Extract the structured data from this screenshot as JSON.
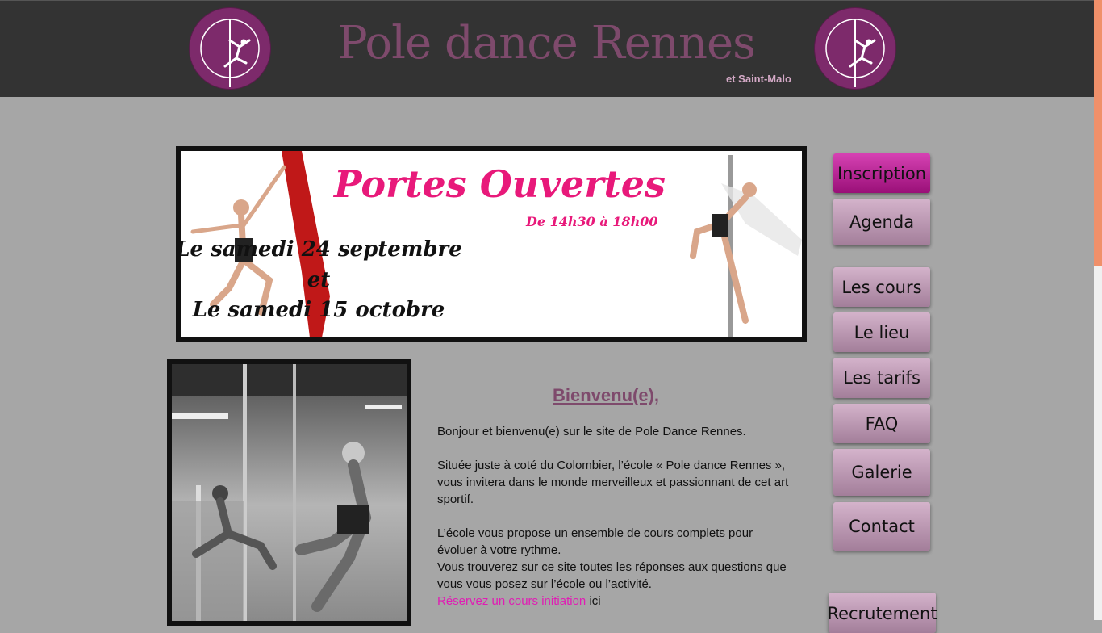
{
  "header": {
    "title": "Pole dance Rennes",
    "subtitle": "et Saint-Malo",
    "logo_text": "Pole Dance Rennes",
    "colors": {
      "background": "#333333",
      "title": "#7e4a6c",
      "logo": "#7d2a6b"
    }
  },
  "banner": {
    "title": "Portes Ouvertes",
    "time": "De 14h30 à 18h00",
    "line1": "Le samedi 24 septembre",
    "line2": "et",
    "line3": "Le samedi 15 octobre"
  },
  "main": {
    "welcome_title": "Bienvenu(e),",
    "paragraph1": "Bonjour et bienvenu(e) sur le site de Pole Dance Rennes.",
    "paragraph2": "Située juste à coté du Colombier, l’école « Pole dance Rennes », vous invitera dans le monde merveilleux et passionnant de cet art sportif.",
    "paragraph3": "L’école vous propose un ensemble de cours complets pour évoluer à votre rythme.",
    "paragraph4": "Vous trouverez sur ce site toutes les réponses aux questions que vous vous posez sur l’école ou l’activité.",
    "cta_text": "Réservez un cours initiation ",
    "cta_link": "ici"
  },
  "nav": {
    "inscription": "Inscription",
    "agenda": "Agenda",
    "cours": "Les cours",
    "lieu": "Le lieu",
    "tarifs": "Les tarifs",
    "faq": "FAQ",
    "galerie": "Galerie",
    "contact": "Contact",
    "recrutement": "Recrutement",
    "colors": {
      "active": "#b0208e",
      "default": "#b995b0"
    }
  }
}
